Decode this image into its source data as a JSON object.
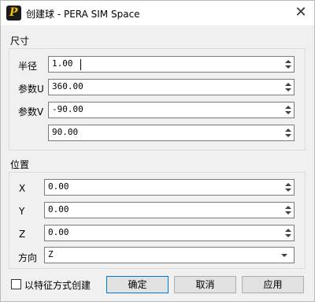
{
  "window": {
    "app_icon_letter": "P",
    "title": "创建球 - PERA SIM Space",
    "close_glyph": "✕"
  },
  "size_section": {
    "label": "尺寸",
    "fields": [
      {
        "label": "半径",
        "value": "1.00"
      },
      {
        "label": "参数U",
        "value": "360.00"
      },
      {
        "label": "参数V",
        "value": "-90.00"
      },
      {
        "label": "",
        "value": "90.00"
      }
    ]
  },
  "position_section": {
    "label": "位置",
    "fields": [
      {
        "label": "X",
        "value": "0.00"
      },
      {
        "label": "Y",
        "value": "0.00"
      },
      {
        "label": "Z",
        "value": "0.00"
      }
    ],
    "direction": {
      "label": "方向",
      "value": "Z"
    }
  },
  "footer": {
    "checkbox_label": "以特征方式创建",
    "checkbox_checked": false,
    "ok_label": "确定",
    "cancel_label": "取消",
    "apply_label": "应用"
  },
  "icons": {
    "close": "close-icon",
    "spin_up": "chevron-up-icon",
    "spin_down": "chevron-down-icon",
    "dropdown": "dropdown-arrow-icon"
  }
}
